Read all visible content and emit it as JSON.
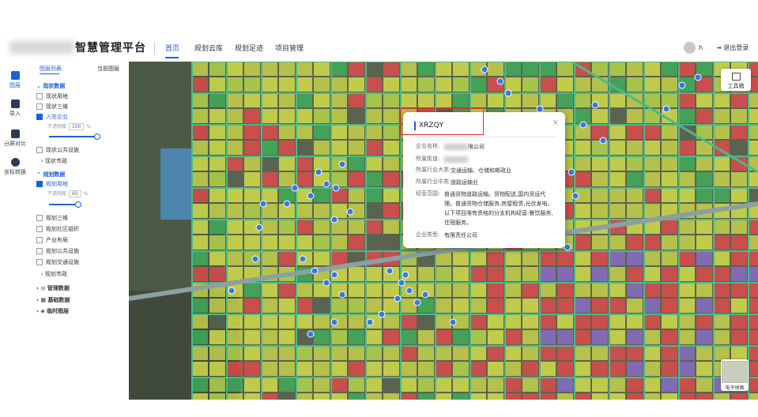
{
  "header": {
    "brand": "智慧管理平台",
    "nav": [
      "首页",
      "规划云库",
      "规划足迹",
      "项目管理"
    ],
    "user": "h",
    "logout": "退出登录"
  },
  "leftbar": {
    "items": [
      "图层",
      "导入",
      "分屏对比",
      "坐标转换"
    ]
  },
  "panel": {
    "tabs": [
      "图层列表",
      "当前图层"
    ],
    "groups": [
      {
        "label": "现状数据",
        "items": [
          "现状用地",
          "现状三维",
          "入驻企业",
          "现状公共设施",
          "现状市政"
        ]
      },
      {
        "label": "规划数据",
        "items": [
          "规划用地",
          "规划三维",
          "规划社区组织",
          "产业布局",
          "规划公共设施",
          "规划交通设施",
          "规划市政"
        ]
      }
    ],
    "opacity_label": "不透明度",
    "opacity_a": "100",
    "opacity_b": "60",
    "percent": "%",
    "opacity_a_level": 1.0,
    "opacity_b_level": 0.6,
    "more": [
      "管理数据",
      "基础数据",
      "临时图层"
    ]
  },
  "toolbox": {
    "label": "工具箱"
  },
  "minimap": {
    "label": "电子地图"
  },
  "popup": {
    "title": "XRZQY",
    "rows": [
      {
        "label": "企业名称:",
        "value": "限公司"
      },
      {
        "label": "所属街道:",
        "value": ""
      },
      {
        "label": "所属行业大类:",
        "value": "交通运输、仓储和邮政业"
      },
      {
        "label": "所属行业中类:",
        "value": "道路运输业"
      },
      {
        "label": "经营范围:",
        "value": "普通货物道路运输。货物配送,国内货运代理。普通货物仓储服务,房屋租赁,光伏发电。以下项目限有资格的分支机构经营:餐饮服务,住宿服务。"
      },
      {
        "label": "企业类型:",
        "value": "有限责任公司"
      }
    ],
    "close": "×"
  },
  "colors": {
    "accent": "#1f5fd6",
    "highlight": "#e0302a"
  }
}
